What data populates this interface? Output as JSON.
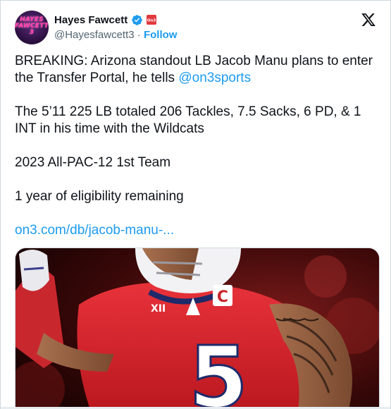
{
  "author": {
    "display_name": "Hayes Fawcett",
    "handle": "@Hayesfawcett3",
    "separator": "·",
    "follow_label": "Follow",
    "avatar_text_line1": "HAYES",
    "avatar_text_line2": "FAWCETT",
    "avatar_text_line3": "3",
    "verified_color": "#1d9bf0",
    "affiliation_color": "#e0393e"
  },
  "tweet": {
    "para1_text": "BREAKING: Arizona standout LB Jacob Manu plans to enter the Transfer Portal, he tells ",
    "para1_mention": "@on3sports",
    "para2": "The 5’11 225 LB totaled 206 Tackles, 7.5 Sacks, 6 PD, & 1 INT in his time with the Wildcats",
    "para3": "2023 All-PAC-12 1st Team",
    "para4": "1 year of eligibility remaining",
    "link": "on3.com/db/jacob-manu-..."
  },
  "media": {
    "jersey_number": "5",
    "captain_patch": "C",
    "jersey_color": "#d9262d"
  },
  "colors": {
    "link": "#1d9bf0",
    "text": "#0f1419",
    "secondary": "#536471"
  }
}
